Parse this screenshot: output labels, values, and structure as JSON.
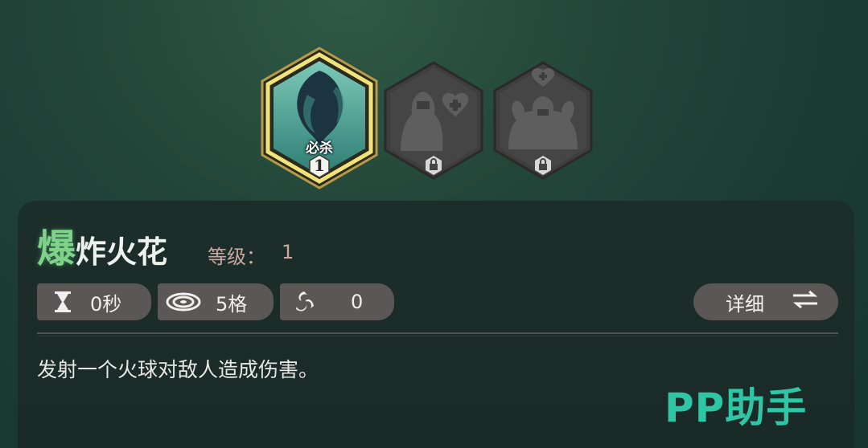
{
  "skills": [
    {
      "name_label": "必杀",
      "rank": "1",
      "state": "selected",
      "icon": "dark-flame-orb-icon"
    },
    {
      "state": "locked",
      "icon": "warrior-heart-silhouette-icon"
    },
    {
      "state": "locked",
      "icon": "strongman-heart-plus-silhouette-icon"
    }
  ],
  "skill_detail": {
    "title_first": "爆",
    "title_rest": "炸火花",
    "level_label": "等级：",
    "level_value": "1",
    "stats": [
      {
        "icon": "hourglass-icon",
        "value": "0秒"
      },
      {
        "icon": "range-rings-icon",
        "value": "5格"
      },
      {
        "icon": "swirl-icon",
        "value": "0"
      }
    ],
    "detail_button": "详细",
    "description": "发射一个火球对敌人造成伤害。"
  },
  "watermark": "PP助手",
  "colors": {
    "accent_gold": "#e9d66b",
    "title_green": "#7fd28a",
    "level_text": "#c8a7a1",
    "watermark": "#2ec6a4"
  }
}
